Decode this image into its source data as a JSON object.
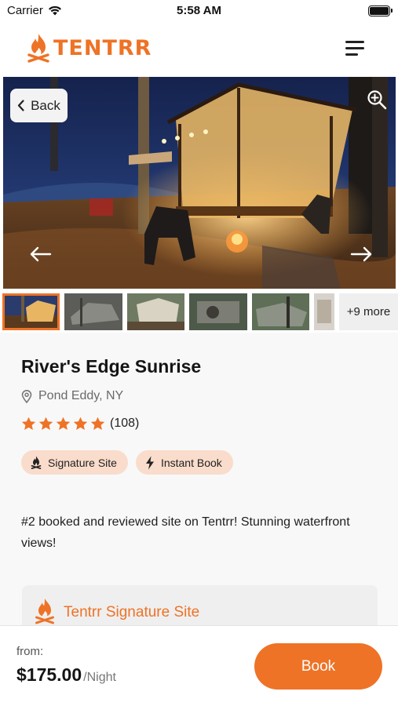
{
  "status_bar": {
    "carrier": "Carrier",
    "time": "5:58 AM"
  },
  "header": {
    "logo_text": "TENTRR",
    "brand_color": "#ee7326"
  },
  "hero": {
    "back_label": "Back",
    "icons": [
      "zoom-in-icon",
      "arrow-left-icon",
      "arrow-right-icon"
    ]
  },
  "gallery": {
    "thumbnail_count": 6,
    "more_label": "+9 more"
  },
  "listing": {
    "title": "River's Edge Sunrise",
    "location": "Pond Eddy, NY",
    "rating_stars": 5,
    "review_count": "(108)",
    "badges": [
      {
        "label": "Signature Site",
        "icon": "campfire-icon"
      },
      {
        "label": "Instant Book",
        "icon": "lightning-icon"
      }
    ],
    "description": "#2 booked and reviewed site on Tentrr! Stunning waterfront views!",
    "signature_card_title": "Tentrr Signature Site"
  },
  "footer": {
    "from_label": "from:",
    "price": "$175.00",
    "unit": "/Night",
    "book_label": "Book"
  },
  "colors": {
    "accent": "#ee7326",
    "badge_bg": "#f9dccb",
    "content_bg": "#f8f8f8"
  }
}
